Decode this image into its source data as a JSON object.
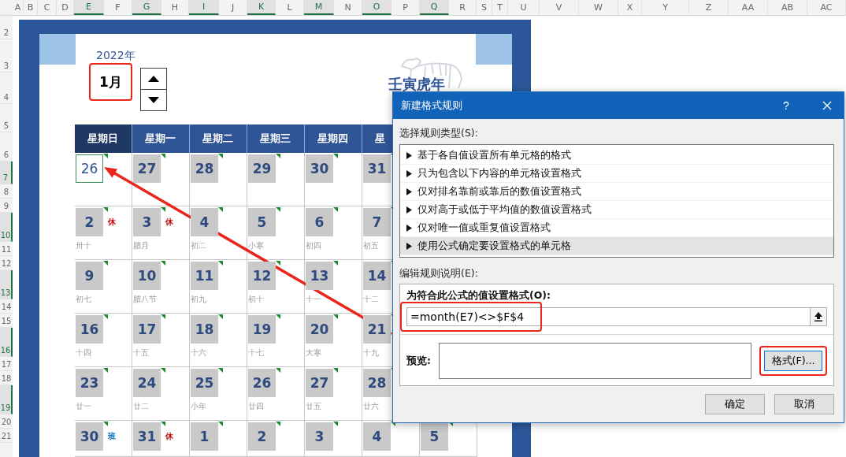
{
  "sheet": {
    "columns": [
      {
        "label": "A",
        "selected": false
      },
      {
        "label": "B",
        "selected": false
      },
      {
        "label": "C",
        "selected": false
      },
      {
        "label": "D",
        "selected": false
      },
      {
        "label": "E",
        "selected": true
      },
      {
        "label": "F",
        "selected": false
      },
      {
        "label": "G",
        "selected": true
      },
      {
        "label": "H",
        "selected": false
      },
      {
        "label": "I",
        "selected": true
      },
      {
        "label": "J",
        "selected": false
      },
      {
        "label": "K",
        "selected": true
      },
      {
        "label": "L",
        "selected": false
      },
      {
        "label": "M",
        "selected": true
      },
      {
        "label": "N",
        "selected": false
      },
      {
        "label": "O",
        "selected": true
      },
      {
        "label": "P",
        "selected": false
      },
      {
        "label": "Q",
        "selected": true
      },
      {
        "label": "R",
        "selected": false
      },
      {
        "label": "S",
        "selected": false
      },
      {
        "label": "T",
        "selected": false
      },
      {
        "label": "U",
        "selected": false
      },
      {
        "label": "V",
        "selected": false
      },
      {
        "label": "W",
        "selected": false
      },
      {
        "label": "X",
        "selected": false
      },
      {
        "label": "Y",
        "selected": false
      },
      {
        "label": "Z",
        "selected": false
      },
      {
        "label": "AA",
        "selected": false
      },
      {
        "label": "AB",
        "selected": false
      },
      {
        "label": "AC",
        "selected": false
      }
    ],
    "rows": [
      {
        "label": "2",
        "selected": false
      },
      {
        "label": "3",
        "selected": false
      },
      {
        "label": "4",
        "selected": false
      },
      {
        "label": "5",
        "selected": false
      },
      {
        "label": "6",
        "selected": false
      },
      {
        "label": "7",
        "selected": true
      },
      {
        "label": "8",
        "selected": false
      },
      {
        "label": "9",
        "selected": false
      },
      {
        "label": "10",
        "selected": true
      },
      {
        "label": "11",
        "selected": false
      },
      {
        "label": "12",
        "selected": false
      },
      {
        "label": "13",
        "selected": true
      },
      {
        "label": "14",
        "selected": false
      },
      {
        "label": "15",
        "selected": false
      },
      {
        "label": "16",
        "selected": true
      },
      {
        "label": "17",
        "selected": false
      },
      {
        "label": "18",
        "selected": false
      },
      {
        "label": "19",
        "selected": true
      },
      {
        "label": "20",
        "selected": false
      },
      {
        "label": "21",
        "selected": false
      }
    ]
  },
  "calendar": {
    "year": "2022年",
    "month": {
      "text": "1月",
      "highlighted": true
    },
    "title": "壬寅虎年",
    "weekdays": [
      {
        "label": "星期日",
        "selected": true
      },
      {
        "label": "星期一",
        "selected": false
      },
      {
        "label": "星期二",
        "selected": false
      },
      {
        "label": "星期三",
        "selected": false
      },
      {
        "label": "星期四",
        "selected": false
      },
      {
        "label": "星",
        "selected": false
      }
    ],
    "weeks": [
      [
        {
          "day": "26",
          "active": true
        },
        {
          "day": "27",
          "active": false
        },
        {
          "day": "28",
          "active": false
        },
        {
          "day": "29",
          "active": false
        },
        {
          "day": "30",
          "active": false
        },
        {
          "day": "31",
          "active": false
        }
      ],
      [
        {
          "day": "2",
          "active": false,
          "note": "休",
          "color": "#c00000",
          "lunar": "卅十"
        },
        {
          "day": "3",
          "active": false,
          "note": "休",
          "color": "#c00000",
          "lunar": "腊月"
        },
        {
          "day": "4",
          "active": false,
          "lunar": "初二"
        },
        {
          "day": "5",
          "active": false,
          "lunar": "小寒"
        },
        {
          "day": "6",
          "active": false,
          "lunar": "初四"
        },
        {
          "day": "7",
          "active": false,
          "lunar": "初五"
        }
      ],
      [
        {
          "day": "9",
          "active": false,
          "lunar": "初七"
        },
        {
          "day": "10",
          "active": false,
          "lunar": "腊八节"
        },
        {
          "day": "11",
          "active": false,
          "lunar": "初九"
        },
        {
          "day": "12",
          "active": false,
          "lunar": "初十"
        },
        {
          "day": "13",
          "active": false,
          "lunar": "十一"
        },
        {
          "day": "14",
          "active": false,
          "lunar": "十二"
        }
      ],
      [
        {
          "day": "16",
          "active": false,
          "lunar": "十四"
        },
        {
          "day": "17",
          "active": false,
          "lunar": "十五"
        },
        {
          "day": "18",
          "active": false,
          "lunar": "十六"
        },
        {
          "day": "19",
          "active": false,
          "lunar": "十七"
        },
        {
          "day": "20",
          "active": false,
          "lunar": "大寒"
        },
        {
          "day": "21",
          "active": false,
          "lunar": "十九"
        }
      ],
      [
        {
          "day": "23",
          "active": false,
          "lunar": "廿一"
        },
        {
          "day": "24",
          "active": false,
          "lunar": "廿二"
        },
        {
          "day": "25",
          "active": false,
          "lunar": "小年"
        },
        {
          "day": "26",
          "active": false,
          "lunar": "廿四"
        },
        {
          "day": "27",
          "active": false,
          "lunar": "廿五"
        },
        {
          "day": "28",
          "active": false,
          "lunar": "廿六"
        }
      ],
      [
        {
          "day": "30",
          "active": false,
          "note": "班",
          "color": "#0070c0"
        },
        {
          "day": "31",
          "active": false,
          "note": "休",
          "color": "#c00000"
        },
        {
          "day": "1",
          "active": false
        },
        {
          "day": "2",
          "active": false
        },
        {
          "day": "3",
          "active": false
        },
        {
          "day": "4",
          "active": false
        },
        {
          "day": "5",
          "active": false
        }
      ]
    ]
  },
  "dialog": {
    "title": "新建格式规则",
    "help": "?",
    "type_label": "选择规则类型(S):",
    "rule_types": [
      {
        "label": "基于各自值设置所有单元格的格式",
        "selected": false
      },
      {
        "label": "只为包含以下内容的单元格设置格式",
        "selected": false
      },
      {
        "label": "仅对排名靠前或靠后的数值设置格式",
        "selected": false
      },
      {
        "label": "仅对高于或低于平均值的数值设置格式",
        "selected": false
      },
      {
        "label": "仅对唯一值或重复值设置格式",
        "selected": false
      },
      {
        "label": "使用公式确定要设置格式的单元格",
        "selected": true
      }
    ],
    "edit_label": "编辑规则说明(E):",
    "formula_label": "为符合此公式的值设置格式(O):",
    "formula": {
      "value": "=month(E7)<>$F$4",
      "highlighted": true
    },
    "preview_label": "预览:",
    "format_button": {
      "label": "格式(F)...",
      "highlighted": true
    },
    "buttons": [
      "确定",
      "取消"
    ]
  }
}
